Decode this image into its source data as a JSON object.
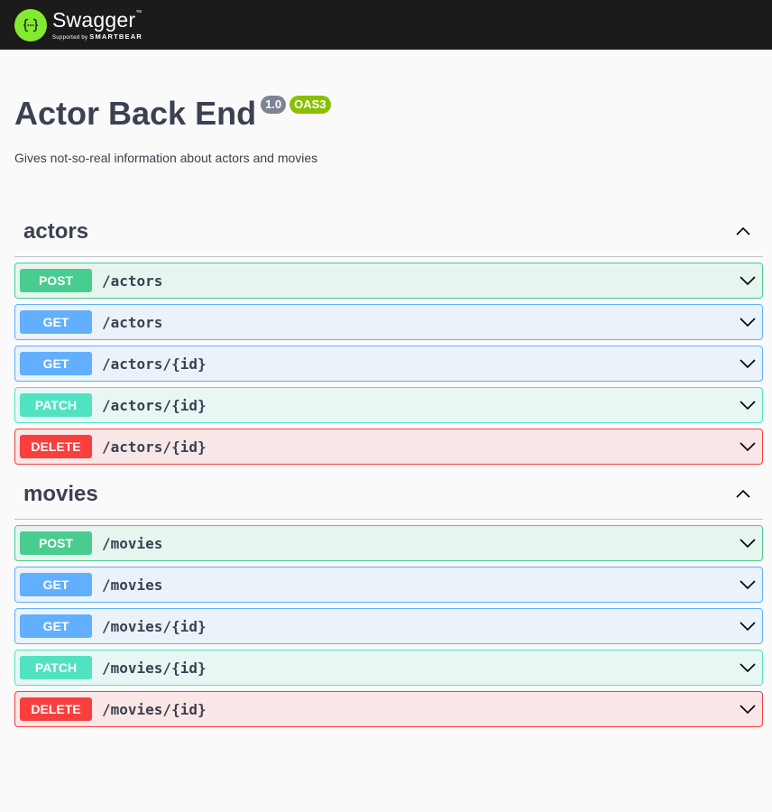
{
  "topbar": {
    "brand": "Swagger",
    "trademark": "™",
    "sub_prefix": "Supported by ",
    "sub_brand": "SMARTBEAR"
  },
  "info": {
    "title": "Actor Back End",
    "version": "1.0",
    "oas": "OAS3",
    "description": "Gives not-so-real information about actors and movies"
  },
  "tags": [
    {
      "name": "actors",
      "operations": [
        {
          "method": "POST",
          "path": "/actors"
        },
        {
          "method": "GET",
          "path": "/actors"
        },
        {
          "method": "GET",
          "path": "/actors/{id}"
        },
        {
          "method": "PATCH",
          "path": "/actors/{id}"
        },
        {
          "method": "DELETE",
          "path": "/actors/{id}"
        }
      ]
    },
    {
      "name": "movies",
      "operations": [
        {
          "method": "POST",
          "path": "/movies"
        },
        {
          "method": "GET",
          "path": "/movies"
        },
        {
          "method": "GET",
          "path": "/movies/{id}"
        },
        {
          "method": "PATCH",
          "path": "/movies/{id}"
        },
        {
          "method": "DELETE",
          "path": "/movies/{id}"
        }
      ]
    }
  ],
  "colors": {
    "post": "#49cc90",
    "get": "#61affe",
    "patch": "#50e3c2",
    "delete": "#f93e3e",
    "topbar": "#1b1b1b",
    "logo": "#85ea2d",
    "version_badge": "#7d8492",
    "oas_badge": "#89bf04"
  },
  "icons": {
    "logo": "swagger-logo-icon",
    "collapse": "chevron-up-icon",
    "expand": "chevron-down-icon"
  }
}
